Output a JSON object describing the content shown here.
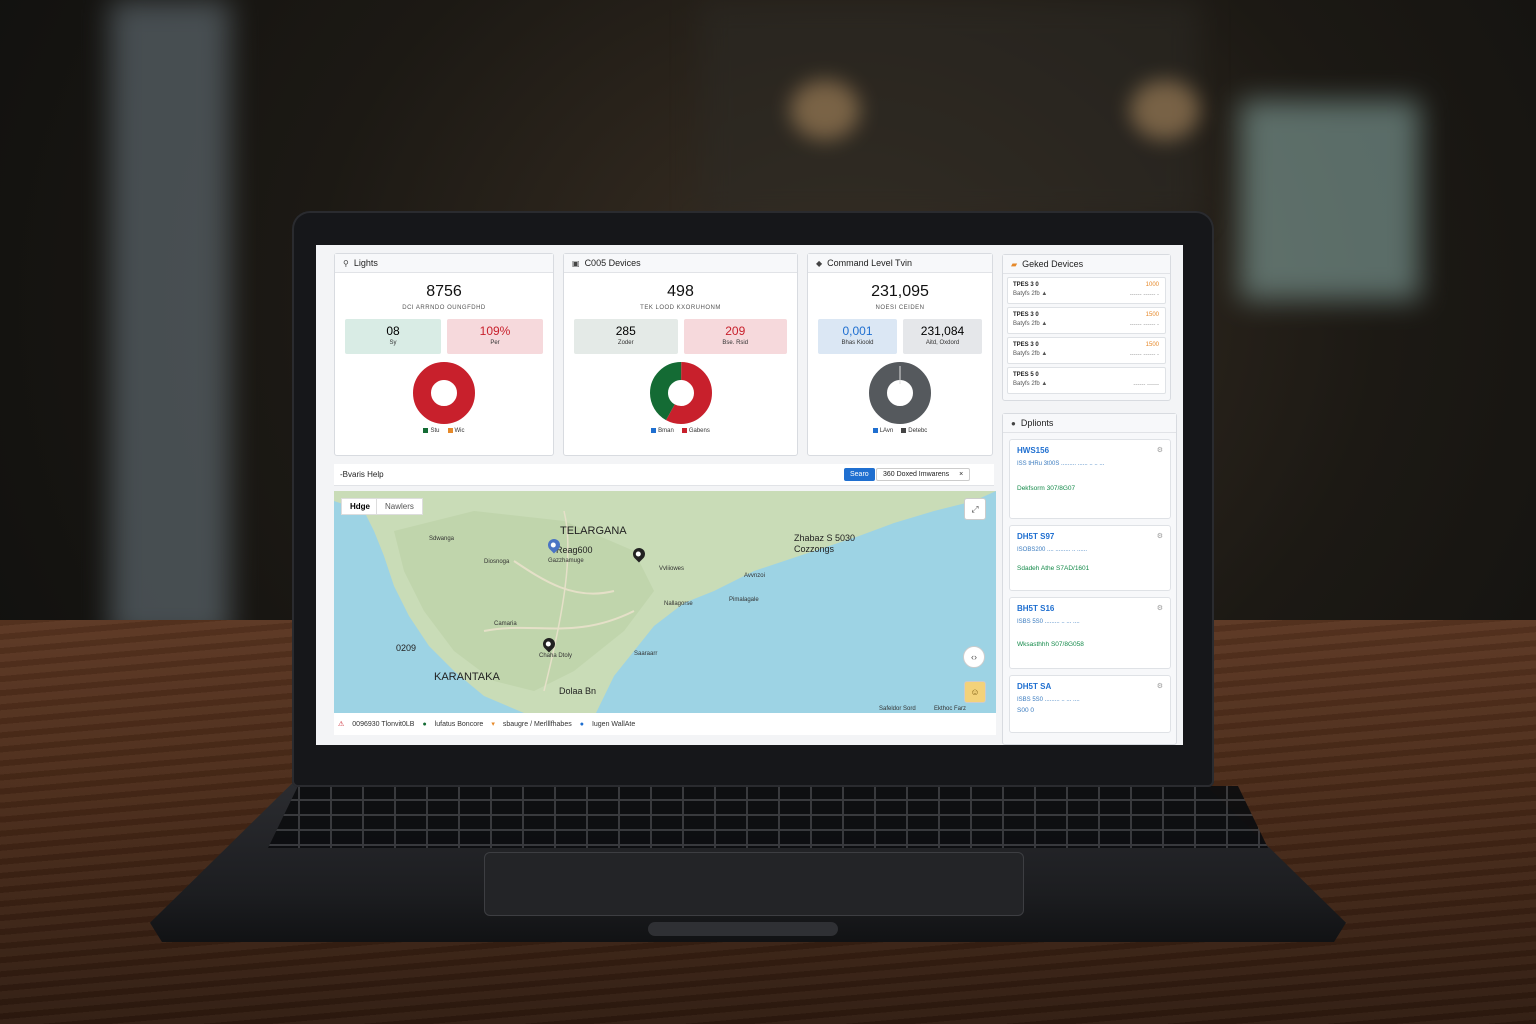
{
  "cards": [
    {
      "title": "Lights",
      "value": "8756",
      "subtitle": "DCI ARRNDO OUNGFDHD",
      "tiles": [
        {
          "value": "08",
          "label": "Sy"
        },
        {
          "value": "109%",
          "label": "Per"
        }
      ],
      "legend": [
        "Stu",
        "Wic"
      ],
      "donut": [
        {
          "share": 100,
          "color": "#c8202c"
        }
      ]
    },
    {
      "title": "C005 Devices",
      "value": "498",
      "subtitle": "TEK LOOD KXORUHONM",
      "tiles": [
        {
          "value": "285",
          "label": "Zoder"
        },
        {
          "value": "209",
          "label": "Bse. Rsid"
        }
      ],
      "legend": [
        "Bman",
        "Gabens"
      ],
      "donut": [
        {
          "share": 58,
          "color": "#c8202c"
        },
        {
          "share": 42,
          "color": "#146b34"
        }
      ]
    },
    {
      "title": "Command Level Tvin",
      "value": "231,095",
      "subtitle": "NOESI CEIDEN",
      "tiles": [
        {
          "value": "0,001",
          "label": "Bhas Kioold"
        },
        {
          "value": "231,084",
          "label": "Aitd, Oxdord"
        }
      ],
      "legend": [
        "LAvn",
        "Detebc"
      ],
      "donut": [
        {
          "share": 100,
          "color": "#55595d"
        }
      ]
    }
  ],
  "colors": {
    "accent": "#1f6fd0",
    "red": "#c8202c",
    "green": "#146b34",
    "gray": "#55595d",
    "orange": "#e6892a"
  },
  "devices_panel": {
    "title": "Geked Devices",
    "rows": [
      {
        "name": "TPES 3 0",
        "value": "1000",
        "meta": "Batyfs 2fb ▲",
        "right": "------ ------ -"
      },
      {
        "name": "TPES 3 0",
        "value": "1500",
        "meta": "Batyfs 2fb ▲",
        "right": "------ ------ -"
      },
      {
        "name": "TPES 3 0",
        "value": "1500",
        "meta": "Batyfs 2fb ▲",
        "right": "------ ------ -"
      },
      {
        "name": "TPES 5 0",
        "value": "",
        "meta": "Batyfs 2fb ▲",
        "right": "------ ------"
      }
    ]
  },
  "options_panel": {
    "title": "Dplionts",
    "items": [
      {
        "name": "HWS156",
        "desc": "ISS tHRu 3t00S ......... ......  .. ..  ...",
        "id": "Dekfsorm   307/8G07"
      },
      {
        "name": "DH5T S97",
        "desc": "ISOBS200 .... .........  ..  ......",
        "id": "Sdadeh Athe   S7AD/1601"
      },
      {
        "name": "BH5T S16",
        "desc": "ISBS 5S0 ......... .. ...  ....",
        "id": "Wksasthhh   S07/8G058"
      },
      {
        "name": "DH5T SA",
        "desc": "ISBS 5S0 ......... .. ...  ....",
        "id": "S00 0"
      }
    ]
  },
  "map_panel": {
    "title": "-Bvaris Help",
    "search_label": "Searo",
    "filter_label": "360 Doxed Imwarens",
    "filter_close": "×",
    "tabs": [
      "Hdge",
      "Nawlers"
    ],
    "labels": {
      "telangana": "TELARGANA",
      "regional": "Reag600",
      "regional_sub": "Gazzhamuge",
      "east": "Zhabaz S 5030",
      "east2": "Cozzongs",
      "karnataka": "KARANTAKA",
      "city1": "Chaha Dtoly",
      "city2": "Dolaa Bn",
      "code": "0209",
      "place1": "Sdwanga",
      "place2": "Diosnoga",
      "place3": "Vvliiowes",
      "place4": "Avvnzoi",
      "place5": "Nallagorse",
      "place6": "Pimalagale",
      "place7": "Camaria",
      "place8": "Saaraarr",
      "attribution_1": "Safeldor Sord",
      "attribution_2": "Ekthoc Farz"
    },
    "footer": [
      {
        "icon": "warning-icon",
        "text": "0096930 Tlonvit0LB"
      },
      {
        "icon": "pin-green-icon",
        "text": "lufatus Boncore"
      },
      {
        "icon": "pin-orange-icon",
        "text": "sbaugre / Merlllfhabes"
      },
      {
        "icon": "pin-blue-icon",
        "text": "Iugen WallAte"
      }
    ]
  }
}
